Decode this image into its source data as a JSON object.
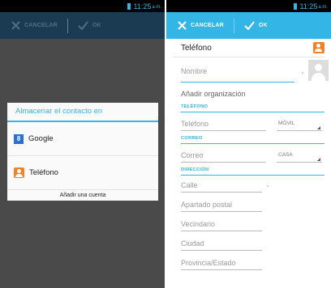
{
  "status": {
    "time": "11:25",
    "ampm": "a.m."
  },
  "actionbar": {
    "cancel_label": "CANCELAR",
    "ok_label": "OK"
  },
  "dialog": {
    "title": "Almacenar el contacto en",
    "items": [
      {
        "label": "Google",
        "icon": "google-icon"
      },
      {
        "label": "Teléfono",
        "icon": "person-icon"
      }
    ],
    "footer": "Añadir una cuenta"
  },
  "editor": {
    "account_label": "Teléfono",
    "name_placeholder": "Nombre",
    "org_label": "Añadir organización",
    "sections": {
      "phone": "TELÉFONO",
      "email": "CORREO",
      "address": "DIRECCIÓN"
    },
    "phone_field": {
      "placeholder": "Teléfono",
      "type": "MÓVIL"
    },
    "email_field": {
      "placeholder": "Correo",
      "type": "CASA"
    },
    "address_fields": [
      "Calle",
      "Apartado postal",
      "Vecindario",
      "Ciudad",
      "Provincia/Estado"
    ]
  },
  "colors": {
    "accent": "#33b5e5",
    "dim_bar": "#1b3b52",
    "overlay": "#4a4a4a",
    "orange": "#f2822a"
  }
}
